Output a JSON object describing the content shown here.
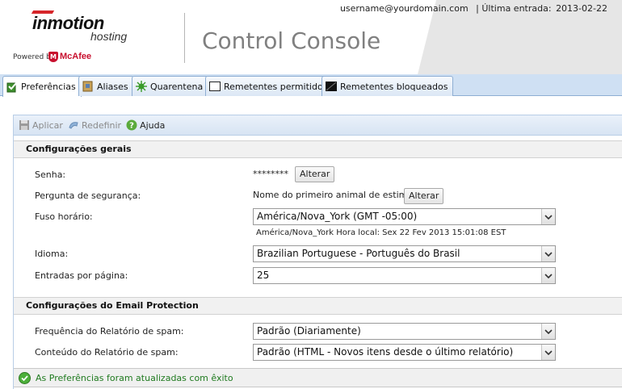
{
  "header": {
    "brand_name": "inmotion",
    "brand_sub": "hosting",
    "powered_by": "Powered by",
    "partner_logo_text": "McAfee",
    "title": "Control Console",
    "username": "username@yourdomain.com",
    "last_login_label": "| Última entrada:",
    "last_login_value": "2013-02-22"
  },
  "tabs": [
    {
      "label": "Preferências",
      "icon": "preferences-icon",
      "active": true
    },
    {
      "label": "Aliases",
      "icon": "aliases-icon",
      "active": false
    },
    {
      "label": "Quarentena",
      "icon": "quarantine-icon",
      "active": false
    },
    {
      "label": "Remetentes permitidos",
      "icon": "allowed-senders-icon",
      "active": false
    },
    {
      "label": "Remetentes bloqueados",
      "icon": "blocked-senders-icon",
      "active": false
    }
  ],
  "toolbar": {
    "apply_label": "Aplicar",
    "reset_label": "Redefinir",
    "help_label": "Ajuda"
  },
  "general": {
    "section_title": "Configurações gerais",
    "password_label": "Senha:",
    "password_value": "********",
    "password_change_label": "Alterar",
    "security_question_label": "Pergunta de segurança:",
    "security_question_value": "Nome do primeiro animal de estimação",
    "security_change_label": "Alterar",
    "timezone_label": "Fuso horário:",
    "timezone_value": "América/Nova_York (GMT -05:00)",
    "timezone_hint": "América/Nova_York Hora local: Sex 22 Fev 2013 15:01:08 EST",
    "language_label": "Idioma:",
    "language_value": "Brazilian Portuguese - Português do Brasil",
    "entries_label": "Entradas por página:",
    "entries_value": "25"
  },
  "email_protection": {
    "section_title": "Configurações do Email Protection",
    "spam_freq_label": "Frequência do Relatório de spam:",
    "spam_freq_value": "Padrão (Diariamente)",
    "spam_content_label": "Conteúdo do Relatório de spam:",
    "spam_content_value": "Padrão (HTML - Novos itens desde o último relatório)"
  },
  "status": {
    "message": "As Preferências foram atualizadas com êxito"
  },
  "colors": {
    "tab_bar": "#cfe0f3",
    "accent_red": "#c8102e",
    "success_green": "#1f7a1f"
  }
}
